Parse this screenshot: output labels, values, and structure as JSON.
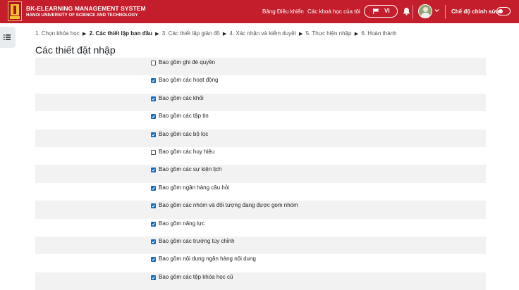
{
  "navbar": {
    "brand_title": "BK-ELEARNING MANAGEMENT SYSTEM",
    "brand_subtitle": "HANOI UNIVERSITY OF SCIENCE AND TECHNOLOGY",
    "links": [
      "Bảng Điều khiển",
      "Các khoá học của tôi"
    ],
    "language": "VI",
    "edit_mode_label": "Chế độ chỉnh sửa",
    "edit_mode_on": false,
    "colors": {
      "primary": "#c41e2d",
      "checkbox": "#0f6cbf"
    }
  },
  "breadcrumb_steps": {
    "step1": "1. Chọn khóa học",
    "step2": "2. Các thiết lập ban đầu",
    "step3": "3. Các thiết lập giản đồ",
    "step4": "4. Xác nhận và kiểm duyệt",
    "step5": "5. Thực hiện nhập",
    "step6": "6. Hoàn thành",
    "separator": "▶"
  },
  "page_title": "Các thiết đặt nhập",
  "settings": [
    {
      "label": "Bao gồm ghi đè quyền",
      "checked": false
    },
    {
      "label": "Bao gồm các hoạt động",
      "checked": true
    },
    {
      "label": "Bao gồm các khối",
      "checked": true
    },
    {
      "label": "Bao gồm các tập tin",
      "checked": true
    },
    {
      "label": "Bao gồm các bộ lọc",
      "checked": true
    },
    {
      "label": "Bao gồm các huy hiệu",
      "checked": false
    },
    {
      "label": "Bao gồm các sự kiện lịch",
      "checked": true
    },
    {
      "label": "Bao gồm ngân hàng câu hỏi",
      "checked": true
    },
    {
      "label": "Bao gồm các nhóm và đối tượng đang được gom nhóm",
      "checked": true
    },
    {
      "label": "Bao gồm năng lực",
      "checked": true
    },
    {
      "label": "Bao gồm các trường tùy chỉnh",
      "checked": true
    },
    {
      "label": "Bao gồm nội dung ngân hàng nội dung",
      "checked": true
    },
    {
      "label": "Bao gồm các tệp khóa học cũ",
      "checked": true
    }
  ]
}
